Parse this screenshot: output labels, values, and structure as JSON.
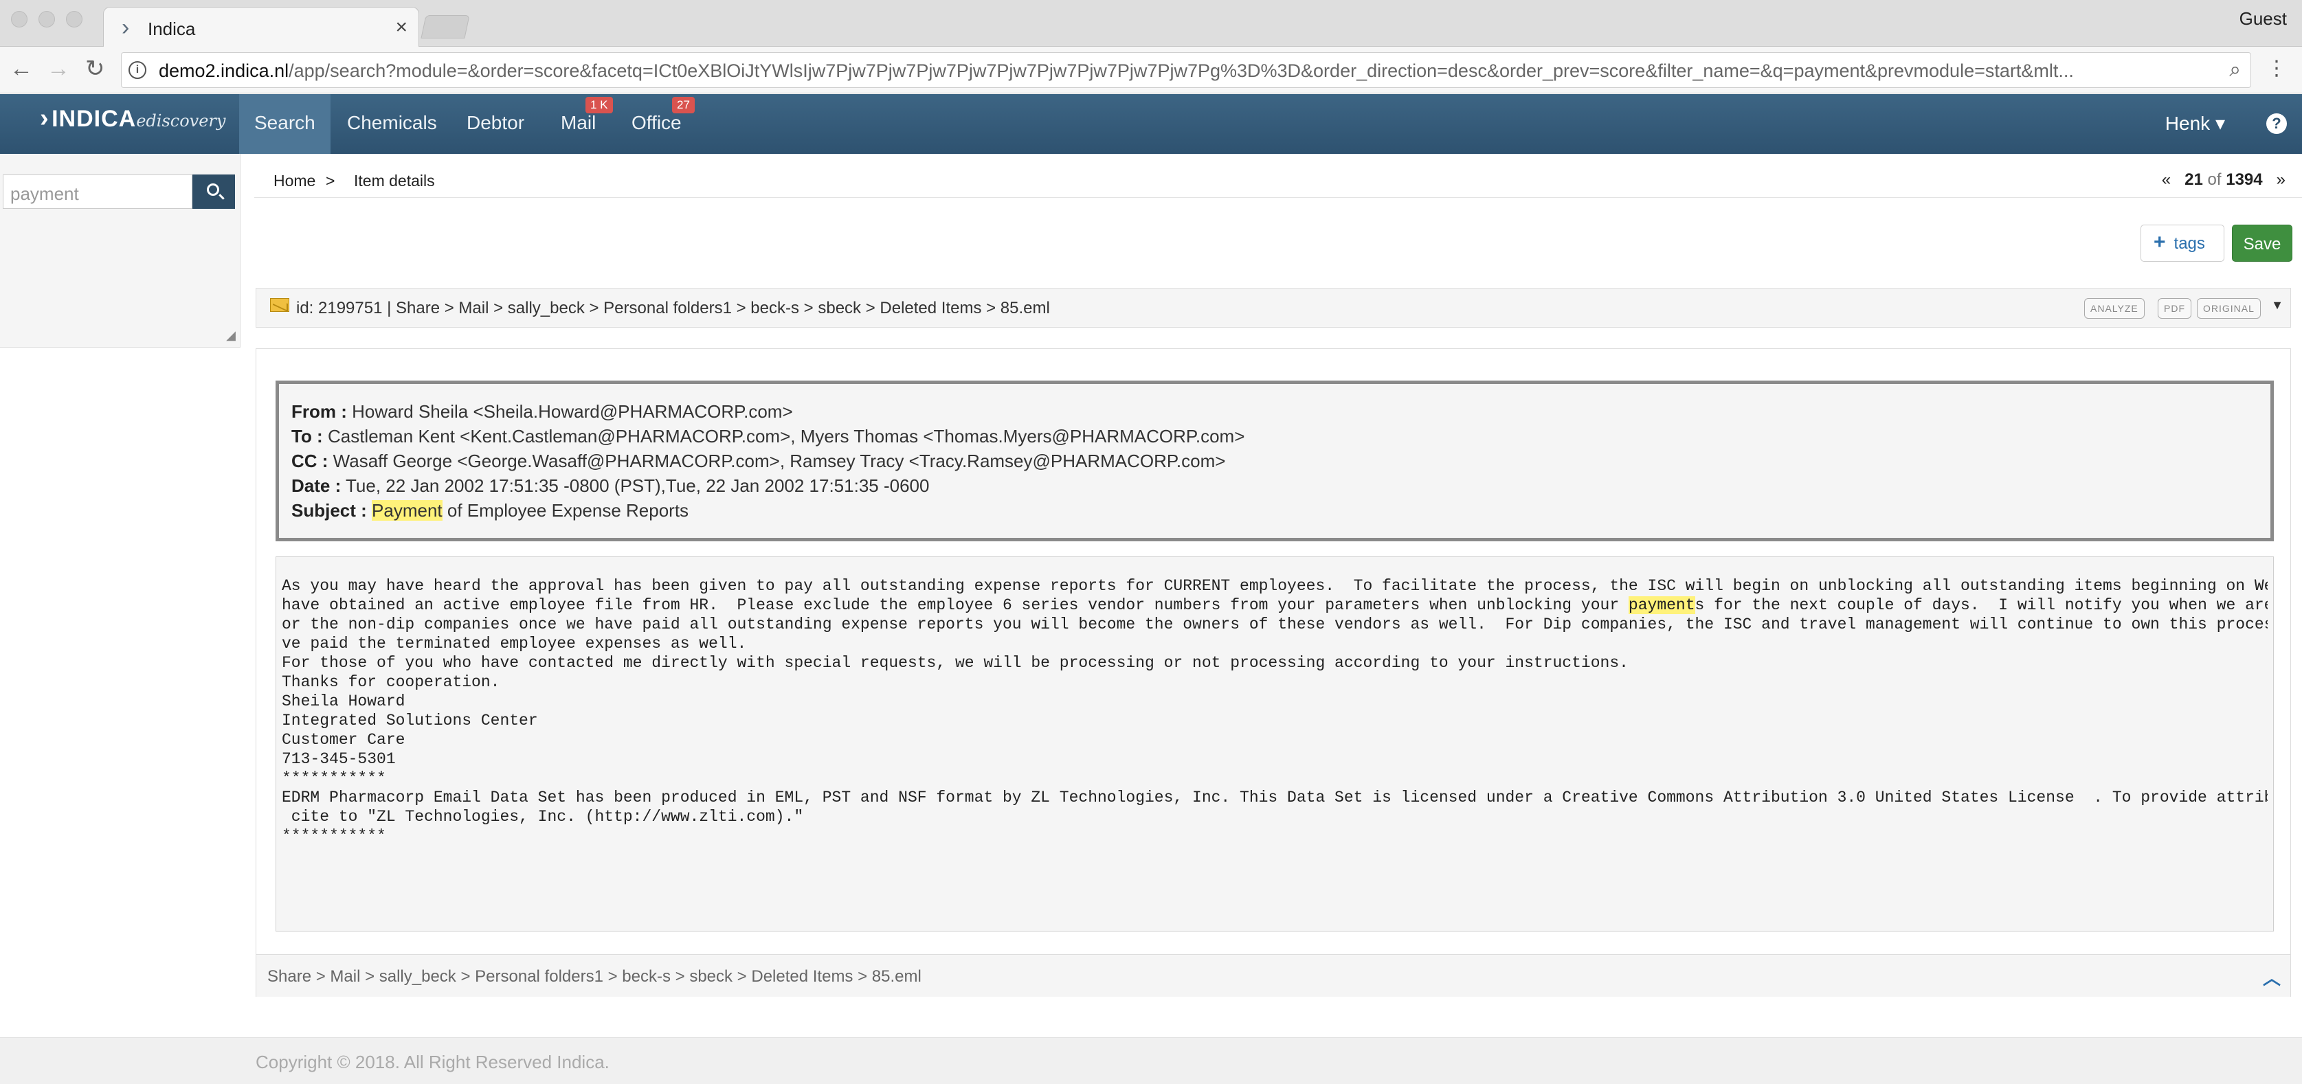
{
  "browser": {
    "tab_title": "Indica",
    "tab_close": "×",
    "profile": "Guest",
    "url_host": "demo2.indica.nl",
    "url_rest": "/app/search?module=&order=score&facetq=ICt0eXBlOiJtYWlsIjw7Pjw7Pjw7Pjw7Pjw7Pjw7Pjw7Pjw7Pjw7Pjw7Pg%3D%3D&order_direction=desc&order_prev=score&filter_name=&q=payment&prevmodule=start&mlt..."
  },
  "navbar": {
    "brand_name": "INDICA",
    "brand_sub": "ediscovery",
    "items": [
      {
        "label": "Search"
      },
      {
        "label": "Chemicals"
      },
      {
        "label": "Debtor"
      },
      {
        "label": "Mail",
        "badge": "1 K"
      },
      {
        "label": "Office",
        "badge": "27"
      }
    ],
    "user": "Henk ▾",
    "help": "?"
  },
  "sidebar": {
    "search_value": "payment"
  },
  "breadcrumb": {
    "home": "Home",
    "sep": ">",
    "current": "Item details"
  },
  "pager": {
    "first": "«",
    "current": "21",
    "of": "of",
    "total": "1394",
    "last": "»"
  },
  "actions": {
    "tags_label": "tags",
    "save_label": "Save"
  },
  "item": {
    "path_line": "id: 2199751 | Share > Mail > sally_beck > Personal folders1 > beck-s > sbeck > Deleted Items > 85.eml",
    "buttons": [
      "ANALYZE",
      "PDF",
      "ORIGINAL"
    ],
    "footer_path": "Share > Mail > sally_beck > Personal folders1 > beck-s > sbeck > Deleted Items > 85.eml"
  },
  "email": {
    "from_label": "From :",
    "from": "Howard Sheila <Sheila.Howard@PHARMACORP.com>",
    "to_label": "To :",
    "to": "Castleman Kent <Kent.Castleman@PHARMACORP.com>, Myers Thomas <Thomas.Myers@PHARMACORP.com>",
    "cc_label": "CC :",
    "cc": "Wasaff George <George.Wasaff@PHARMACORP.com>, Ramsey Tracy <Tracy.Ramsey@PHARMACORP.com>",
    "date_label": "Date :",
    "date": "Tue, 22 Jan 2002 17:51:35 -0800 (PST),Tue, 22 Jan 2002 17:51:35 -0600",
    "subject_label": "Subject :",
    "subject_highlight": "Payment",
    "subject_rest": " of Employee Expense Reports",
    "body_lines": [
      "As you may have heard the approval has been given to pay all outstanding expense reports for CURRENT employees.  To facilitate the process, the ISC will begin on unblocking all outstanding items beginning on Wednesday.   We",
      "have obtained an active employee file from HR.  Please exclude the employee 6 series vendor numbers from your parameters when unblocking your ",
      "or the non-dip companies once we have paid all outstanding expense reports you will become the owners of these vendors as well.  For Dip companies, the ISC and travel management will continue to own this process until we ha",
      "ve paid the terminated employee expenses as well.",
      "",
      "For those of you who have contacted me directly with special requests, we will be processing or not processing according to your instructions.",
      "",
      "Thanks for cooperation.",
      "",
      "Sheila Howard",
      "Integrated Solutions Center",
      "Customer Care",
      "713-345-5301",
      "",
      "***********",
      "EDRM Pharmacorp Email Data Set has been produced in EML, PST and NSF format by ZL Technologies, Inc. This Data Set is licensed under a Creative Commons Attribution 3.0 United States License  . To provide attribution, please",
      " cite to \"ZL Technologies, Inc. (http://www.zlti.com).\"",
      "***********"
    ],
    "body_line2_highlight": "payment",
    "body_line2_rest": "s for the next couple of days.  I will notify you when we are finished.  F"
  },
  "footer": {
    "copyright": "Copyright © 2018. All Right Reserved Indica."
  }
}
